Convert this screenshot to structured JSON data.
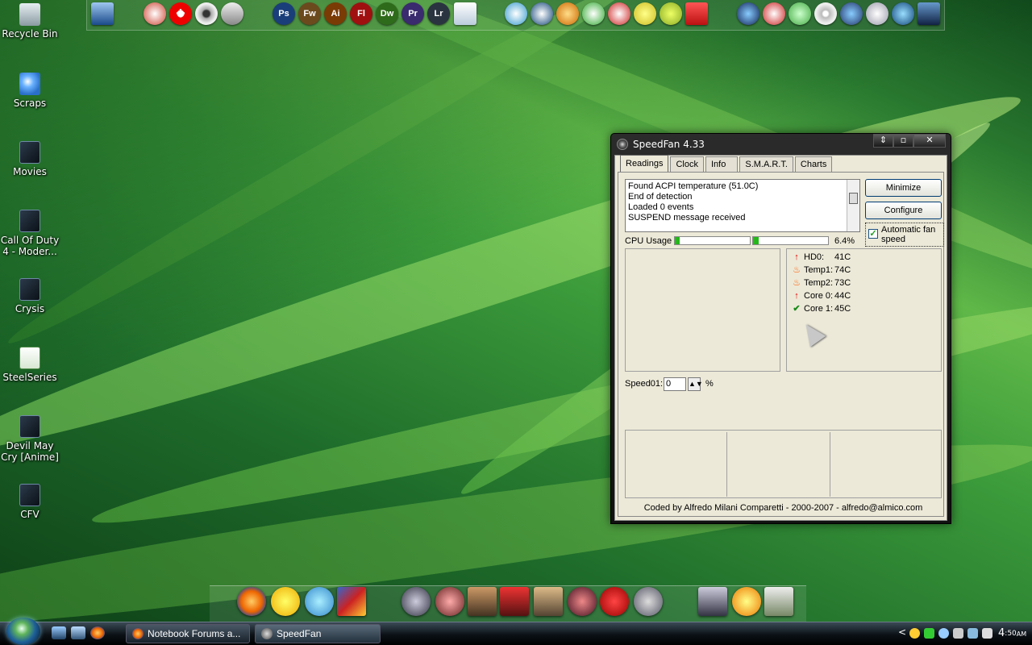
{
  "desktop": {
    "icons": [
      {
        "label": "Recycle Bin",
        "icon": "recycle-bin-icon"
      },
      {
        "label": "Scraps",
        "icon": "windows-folder-icon"
      },
      {
        "label": "Movies",
        "icon": "shortcut-icon"
      },
      {
        "label": "Call Of Duty 4 - Moder...",
        "icon": "shortcut-icon"
      },
      {
        "label": "Crysis",
        "icon": "shortcut-icon"
      },
      {
        "label": "SteelSeries",
        "icon": "excel-file-icon"
      },
      {
        "label": "Devil May Cry [Anime]",
        "icon": "shortcut-icon"
      },
      {
        "label": "CFV",
        "icon": "shortcut-icon"
      }
    ]
  },
  "top_dock": {
    "labels": [
      "Ps",
      "Fw",
      "Ai",
      "Fl",
      "Dw",
      "Pr",
      "Lr"
    ],
    "colors": {
      "ps": "#1a3e7a",
      "fw": "#6b4a1e",
      "ai": "#7a3b05",
      "fl": "#a01010",
      "dw": "#2e6b1a",
      "pr": "#3a2a6e",
      "lr": "#2a3440"
    }
  },
  "speedfan": {
    "title": "SpeedFan 4.33",
    "window_buttons": {
      "restore": "⇕",
      "maximize": "▫",
      "close": "✕"
    },
    "tabs": [
      "Readings",
      "Clock",
      "Info",
      "S.M.A.R.T.",
      "Charts"
    ],
    "active_tab": "Readings",
    "log": [
      "Found ACPI temperature (51.0C)",
      "End of detection",
      "Loaded 0 events",
      "SUSPEND message received"
    ],
    "buttons": {
      "minimize": "Minimize",
      "configure": "Configure"
    },
    "automatic_fan_speed": {
      "label": "Automatic fan speed",
      "checked": true
    },
    "cpu_usage": {
      "label": "CPU Usage",
      "value": "6.4%",
      "bar1_fraction": 0.06,
      "bar2_fraction": 0.07
    },
    "temperatures": [
      {
        "name": "HD0:",
        "value": "41C",
        "icon": "up-arrow-icon"
      },
      {
        "name": "Temp1:",
        "value": "74C",
        "icon": "fire-icon"
      },
      {
        "name": "Temp2:",
        "value": "73C",
        "icon": "fire-icon"
      },
      {
        "name": "Core 0:",
        "value": "44C",
        "icon": "up-arrow-icon"
      },
      {
        "name": "Core 1:",
        "value": "45C",
        "icon": "check-icon"
      }
    ],
    "speed": {
      "label": "Speed01:",
      "value": "0",
      "unit": "%"
    },
    "footer": "Coded by Alfredo Milani Comparetti - 2000-2007 - alfredo@almico.com"
  },
  "taskbar": {
    "buttons": [
      {
        "label": "Notebook Forums a...",
        "active": false
      },
      {
        "label": "SpeedFan",
        "active": true
      }
    ],
    "tray": {
      "expand": "<",
      "clock_hour": "4",
      "clock_min": ":50",
      "clock_ampm": "AM"
    }
  }
}
